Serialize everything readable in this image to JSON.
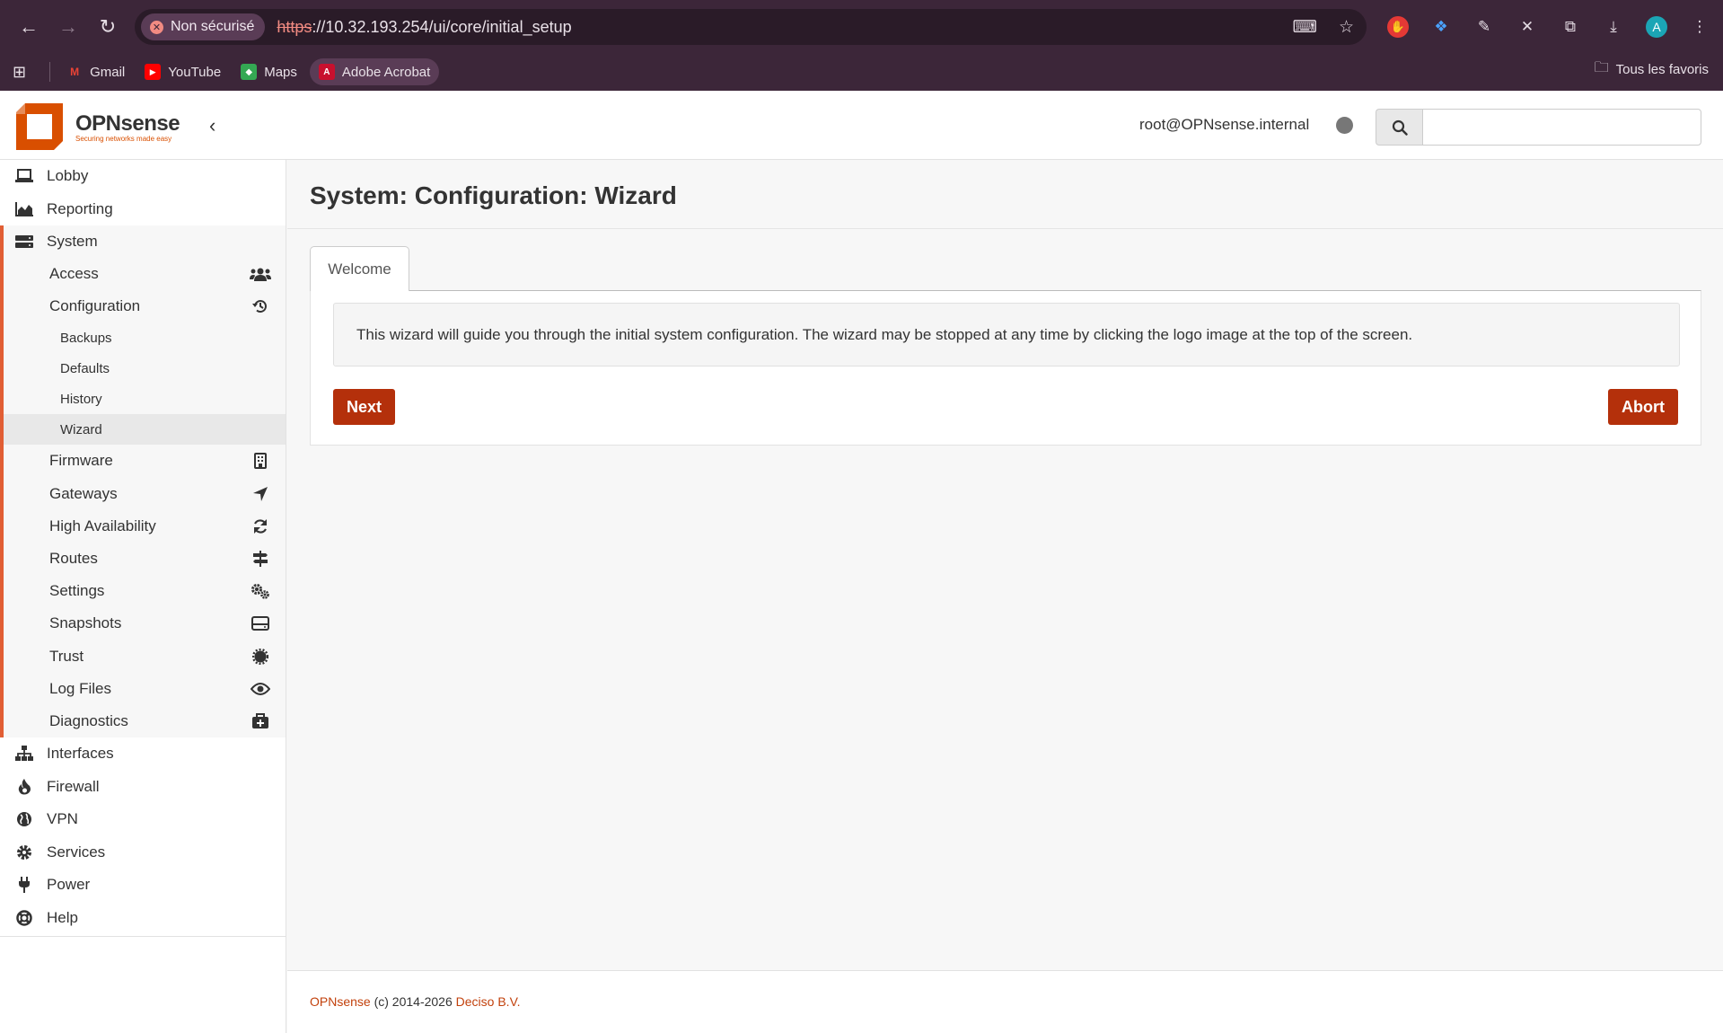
{
  "browser": {
    "security_label": "Non sécurisé",
    "url_scheme": "https",
    "url_rest": "://10.32.193.254/ui/core/initial_setup",
    "bookmarks": [
      {
        "label": "Gmail"
      },
      {
        "label": "YouTube"
      },
      {
        "label": "Maps"
      },
      {
        "label": "Adobe Acrobat"
      }
    ],
    "all_favorites": "Tous les favoris",
    "profile_initial": "A"
  },
  "header": {
    "brand": "OPNsense",
    "tagline": "Securing networks made easy",
    "user": "root@OPNsense.internal",
    "search_placeholder": ""
  },
  "sidebar": {
    "top_items": [
      {
        "label": "Lobby",
        "icon": "laptop-icon"
      },
      {
        "label": "Reporting",
        "icon": "area-chart-icon"
      }
    ],
    "system": {
      "label": "System",
      "icon": "server-icon",
      "items": [
        {
          "label": "Access",
          "icon": "users-icon"
        },
        {
          "label": "Configuration",
          "icon": "history-icon"
        }
      ],
      "config_sub": [
        {
          "label": "Backups"
        },
        {
          "label": "Defaults"
        },
        {
          "label": "History"
        },
        {
          "label": "Wizard"
        }
      ],
      "more_items": [
        {
          "label": "Firmware",
          "icon": "building-icon"
        },
        {
          "label": "Gateways",
          "icon": "location-arrow-icon"
        },
        {
          "label": "High Availability",
          "icon": "refresh-icon"
        },
        {
          "label": "Routes",
          "icon": "signpost-icon"
        },
        {
          "label": "Settings",
          "icon": "cogs-icon"
        },
        {
          "label": "Snapshots",
          "icon": "hdd-icon"
        },
        {
          "label": "Trust",
          "icon": "certificate-icon"
        },
        {
          "label": "Log Files",
          "icon": "eye-icon"
        },
        {
          "label": "Diagnostics",
          "icon": "medkit-icon"
        }
      ]
    },
    "bottom_items": [
      {
        "label": "Interfaces",
        "icon": "sitemap-icon"
      },
      {
        "label": "Firewall",
        "icon": "fire-icon"
      },
      {
        "label": "VPN",
        "icon": "globe-icon"
      },
      {
        "label": "Services",
        "icon": "cog-icon"
      },
      {
        "label": "Power",
        "icon": "plug-icon"
      },
      {
        "label": "Help",
        "icon": "life-ring-icon"
      }
    ]
  },
  "main": {
    "title": "System: Configuration: Wizard",
    "tab": "Welcome",
    "message": "This wizard will guide you through the initial system configuration. The wizard may be stopped at any time by clicking the logo image at the top of the screen.",
    "next_label": "Next",
    "abort_label": "Abort"
  },
  "footer": {
    "brand": "OPNsense",
    "copyright": " (c) 2014-2026 ",
    "company": "Deciso B.V."
  },
  "colors": {
    "accent": "#b4300b",
    "brand_orange": "#d94f00",
    "chrome": "#3c2639"
  }
}
